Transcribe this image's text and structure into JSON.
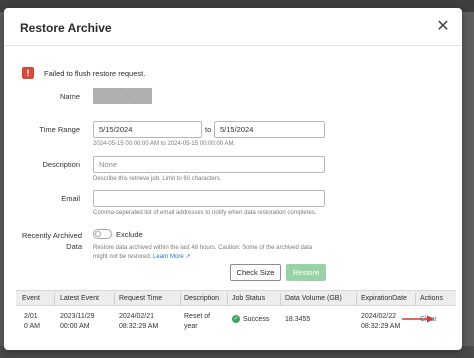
{
  "dialog": {
    "title": "Restore Archive",
    "close_glyph": "✕"
  },
  "alert": {
    "icon": "alert-icon",
    "glyph": "!",
    "message": "Failed to flush restore request.",
    "color": "#d9483b"
  },
  "form": {
    "name_label": "Name",
    "time_range": {
      "label": "Time Range",
      "from_value": "5/15/2024",
      "separator": "to",
      "to_value": "5/15/2024",
      "help": "2024-05-15 00:00:00 AM to 2024-05-15 00:00:00 AM."
    },
    "description": {
      "label": "Description",
      "placeholder": "None",
      "help": "Describe this retrieve job. Limit to 60 characters."
    },
    "email": {
      "label": "Email",
      "placeholder": "",
      "help": "Comma-seperated list of email addresses to notify when data restoration completes."
    },
    "recently_archived": {
      "label_line1": "Recently Archived",
      "label_line2": "Data",
      "toggle_label": "Exclude",
      "toggle_on": false,
      "help_line1": "Restore data archived within the last 48 hours. Caution: Some of the archived data",
      "help_line2": "might not be restored.",
      "learn_more": "Learn More",
      "learn_more_icon": "external-link-icon"
    },
    "buttons": {
      "check_size": "Check Size",
      "restore": "Restore"
    }
  },
  "table": {
    "columns": [
      "Event",
      "Latest Event",
      "Request Time",
      "Description",
      "Job Status",
      "Data Volume (GB)",
      "ExpirationDate",
      "Actions"
    ],
    "rows": [
      {
        "event": [
          "2/01",
          "0 AM"
        ],
        "latest_event": [
          "2023/11/29",
          "00:00 AM"
        ],
        "request_time": [
          "2024/02/21",
          "08:32:29 AM"
        ],
        "description": [
          "Reset of",
          "year"
        ],
        "job_status": "Success",
        "data_volume": "18.3455",
        "expiration": [
          "2024/02/22",
          "08:32:29 AM"
        ],
        "action": "Clear"
      }
    ]
  },
  "colors": {
    "accent_link": "#2a72c9",
    "success": "#3aa55c",
    "restore_button": "#97d3a7",
    "annotation_arrow": "#e0332a"
  }
}
